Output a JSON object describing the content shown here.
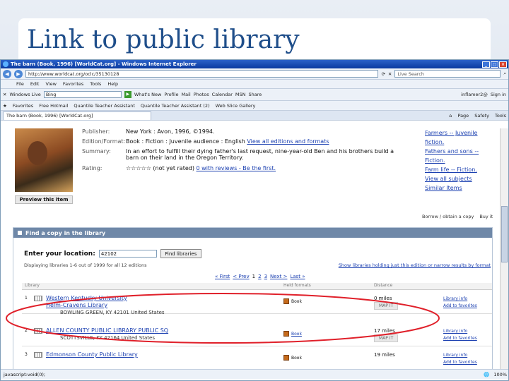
{
  "slide": {
    "title": "Link to public library"
  },
  "browser": {
    "window_title": "The barn (Book, 1996) [WorldCat.org] - Windows Internet Explorer",
    "address": "http://www.worldcat.org/oclc/35130128",
    "search_engine": "Live Search",
    "menu": [
      "File",
      "Edit",
      "View",
      "Favorites",
      "Tools",
      "Help"
    ],
    "toolbar_label": "Windows Live",
    "toolbar_search": "Bing",
    "toolbar_items": [
      "What's New",
      "Profile",
      "Mail",
      "Photos",
      "Calendar",
      "MSN",
      "Share"
    ],
    "toolbar_right": "inflamer2@",
    "toolbar_signin": "Sign in",
    "favorites_label": "Favorites",
    "favorites_items": [
      "Free Hotmail",
      "Quantile Teacher Assistant",
      "Quantile Teacher Assistant (2)",
      "Web Slice Gallery"
    ],
    "tab_title": "The barn (Book, 1996) [WorldCat.org]",
    "tab_right": [
      "Page",
      "Safety",
      "Tools"
    ],
    "status_url": "javascript:void(0);",
    "status_right": "100%"
  },
  "record": {
    "rows": [
      {
        "k": "Publisher:",
        "v": "New York : Avon, 1996, ©1994."
      },
      {
        "k": "Edition/Format:",
        "v": "Book : Fiction : Juvenile audience : English",
        "link": "View all editions and formats"
      },
      {
        "k": "Summary:",
        "v": "In an effort to fulfill their dying father's last request, nine-year-old Ben and his brothers build a barn on their land in the Oregon Territory."
      },
      {
        "k": "Rating:",
        "v": "(not yet rated)",
        "link": "0 with reviews - Be the first."
      }
    ],
    "preview": "Preview this item",
    "subjects": [
      "Farmers -- Juvenile fiction.",
      "Fathers and sons -- Fiction.",
      "Farm life -- Fiction.",
      "View all subjects"
    ],
    "similar": "Similar Items",
    "borrow": "Borrow / obtain a copy",
    "buy": "Buy it"
  },
  "library": {
    "heading": "Find a copy in the library",
    "location_label": "Enter your location:",
    "location_value": "42102",
    "find_button": "Find libraries",
    "displaying": "Displaying libraries 1-6 out of 1999 for all 12 editions",
    "show_right": "Show libraries holding just this edition or narrow results by format",
    "pager": [
      "« First",
      "< Prev",
      "1",
      "2",
      "3",
      "Next >",
      "Last »"
    ],
    "col_library": "Library",
    "col_format": "Held formats",
    "col_distance": "Distance",
    "rows": [
      {
        "num": "1",
        "name": "Western Kentucky University",
        "sub": "Helm-Cravens Library",
        "addr": "BOWLING GREEN, KY 42101 United States",
        "format": "Book",
        "dist": "0 miles",
        "map": "MAP IT",
        "info": "Library info",
        "fav": "Add to favorites"
      },
      {
        "num": "2",
        "name": "ALLEN COUNTY PUBLIC LIBRARY PUBLIC SQ",
        "sub": "",
        "addr": "SCOTTSVILLE, KY 42164 United States",
        "format": "Book",
        "dist": "17 miles",
        "map": "MAP IT",
        "info": "Library info",
        "fav": "Add to favorites"
      },
      {
        "num": "3",
        "name": "Edmonson County Public Library",
        "sub": "",
        "addr": "",
        "format": "Book",
        "dist": "19 miles",
        "map": "",
        "info": "Library info",
        "fav": "Add to favorites"
      }
    ]
  },
  "colors": {
    "title": "#1f4e8a",
    "highlight": "#e0202a",
    "link": "#1a3fb0"
  },
  "icons": [
    "ie-icon",
    "back-icon",
    "forward-icon",
    "refresh-icon",
    "stop-icon",
    "search-icon",
    "star-icon",
    "book-icon",
    "building-icon"
  ]
}
